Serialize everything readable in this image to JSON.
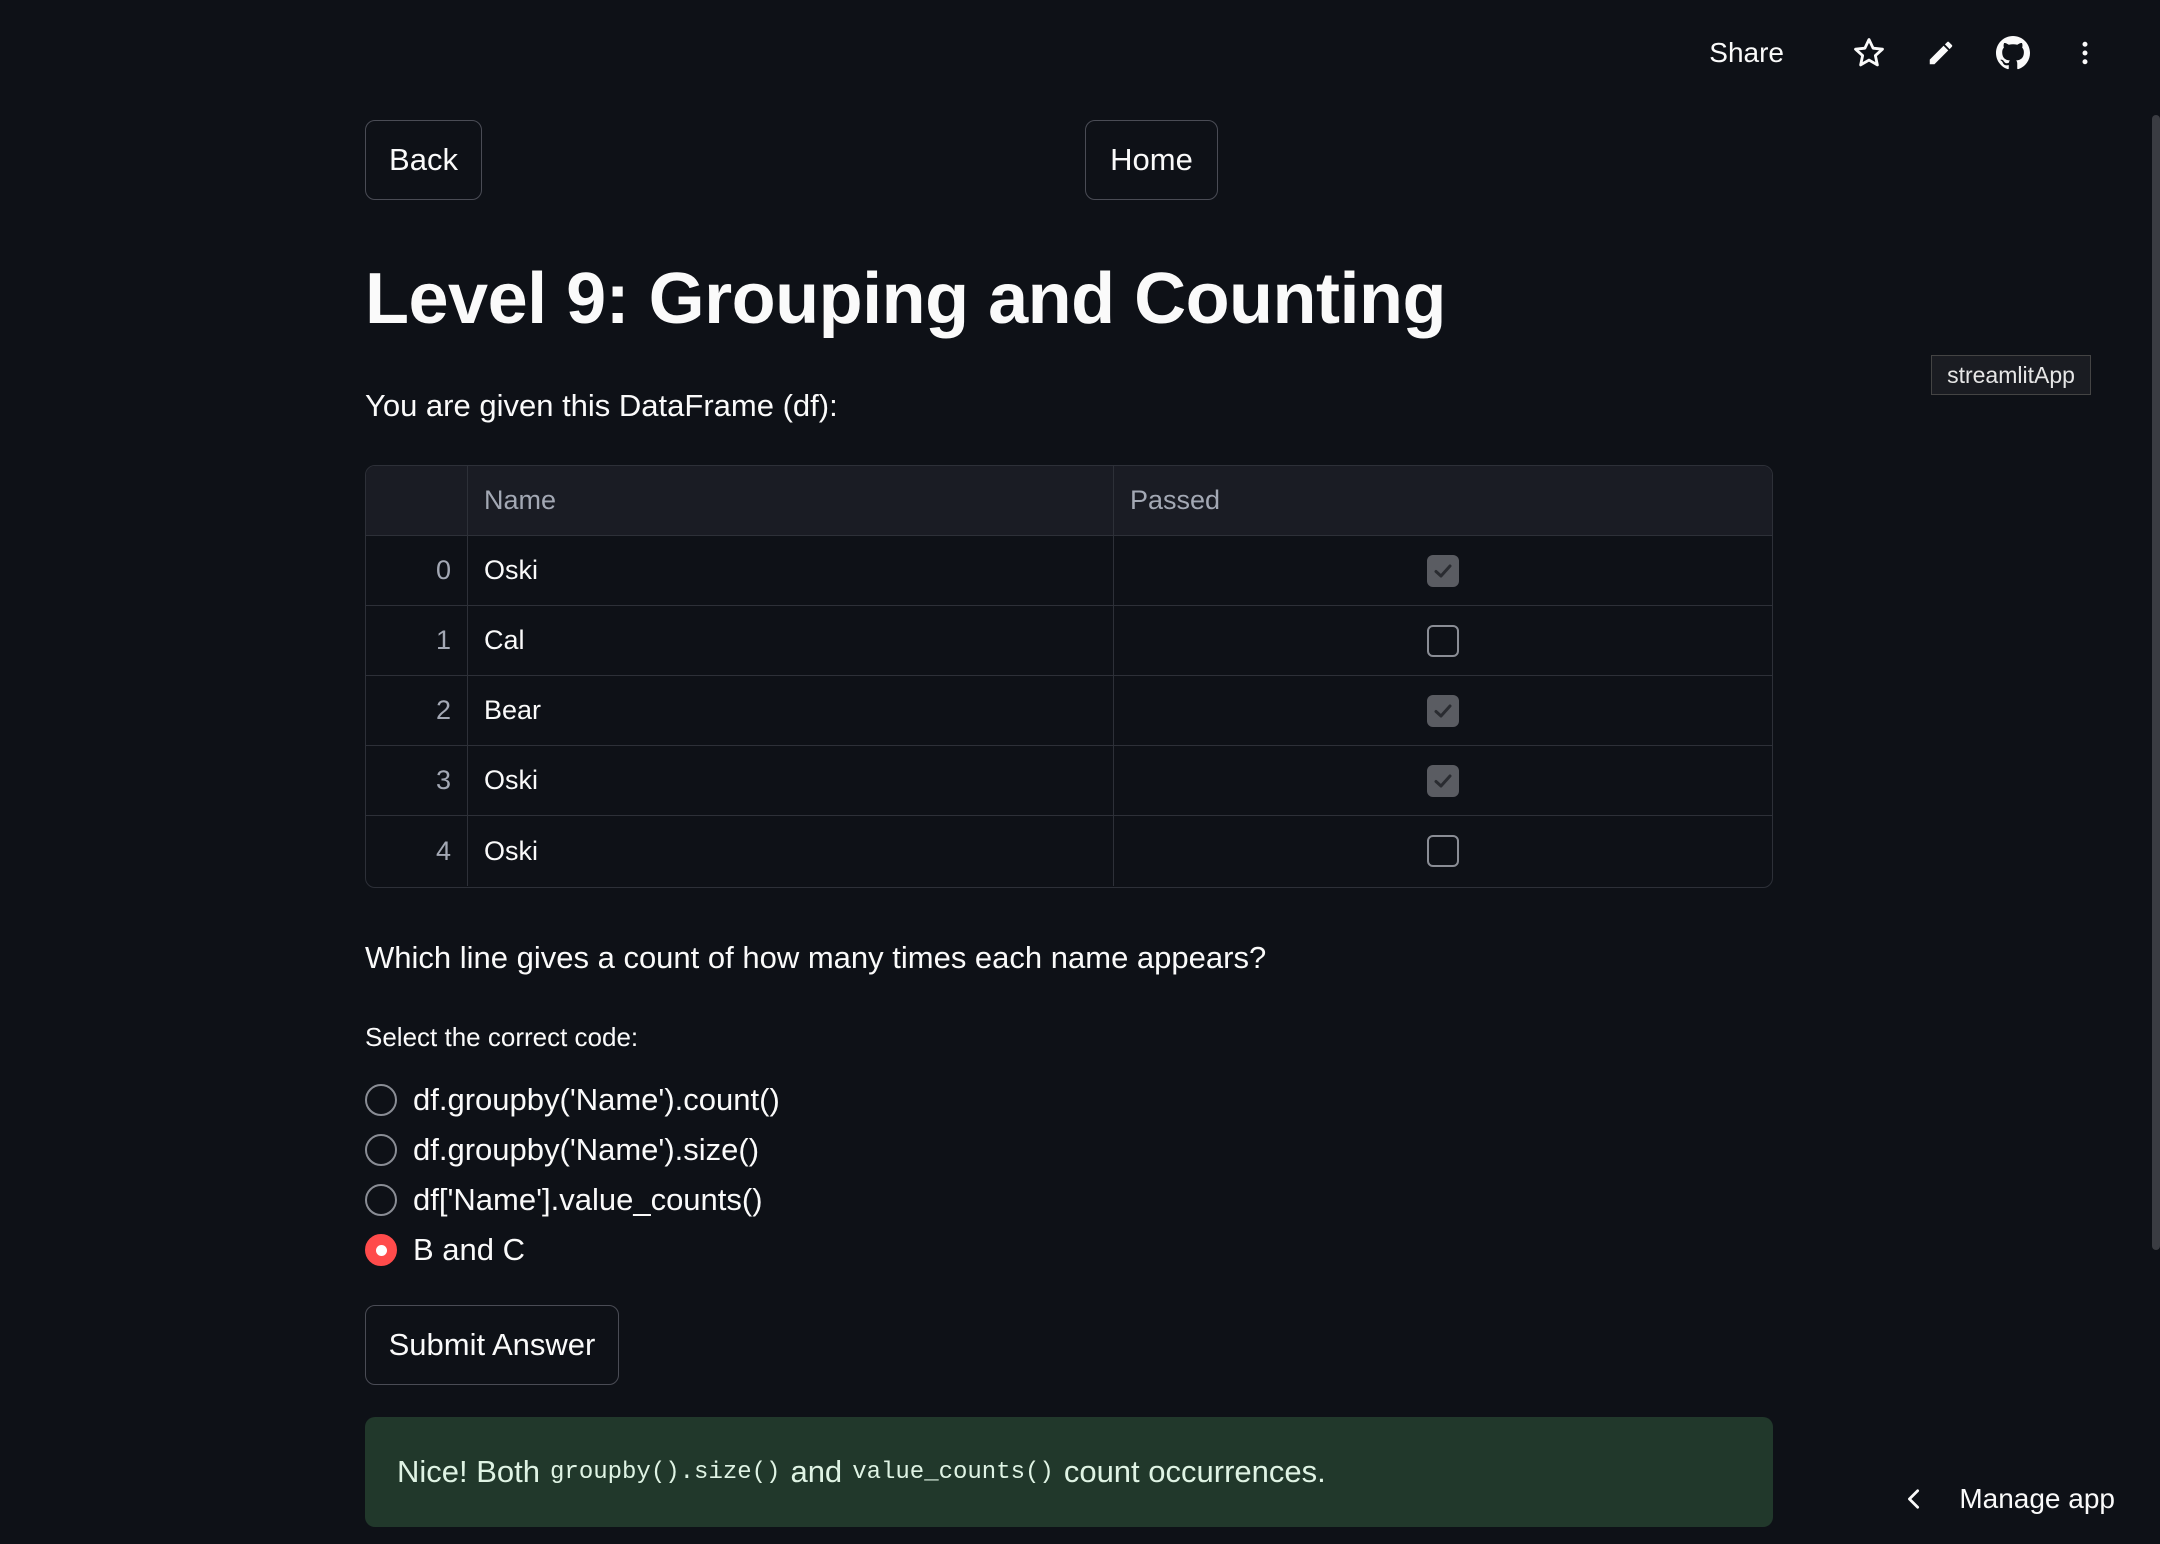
{
  "header": {
    "share_label": "Share",
    "icons": [
      "star-icon",
      "pencil-icon",
      "github-icon",
      "more-vert-icon"
    ]
  },
  "nav": {
    "back_label": "Back",
    "home_label": "Home"
  },
  "page": {
    "title": "Level 9: Grouping and Counting",
    "intro": "You are given this DataFrame (df):",
    "tooltip": "streamlitApp"
  },
  "dataframe": {
    "columns": [
      "Name",
      "Passed"
    ],
    "rows": [
      {
        "index": "0",
        "name": "Oski",
        "passed": true
      },
      {
        "index": "1",
        "name": "Cal",
        "passed": false
      },
      {
        "index": "2",
        "name": "Bear",
        "passed": true
      },
      {
        "index": "3",
        "name": "Oski",
        "passed": true
      },
      {
        "index": "4",
        "name": "Oski",
        "passed": false
      }
    ]
  },
  "quiz": {
    "question": "Which line gives a count of how many times each name appears?",
    "radio_label": "Select the correct code:",
    "options": [
      "df.groupby('Name').count()",
      "df.groupby('Name').size()",
      "df['Name'].value_counts()",
      "B and C"
    ],
    "selected_index": 3,
    "submit_label": "Submit Answer"
  },
  "feedback": {
    "prefix": "Nice! Both",
    "code1": "groupby().size()",
    "middle": "and",
    "code2": "value_counts()",
    "suffix": "count occurrences."
  },
  "footer": {
    "manage_label": "Manage app"
  },
  "colors": {
    "background": "#0e1117",
    "accent": "#ff4b4b",
    "success_bg": "#21382b"
  }
}
